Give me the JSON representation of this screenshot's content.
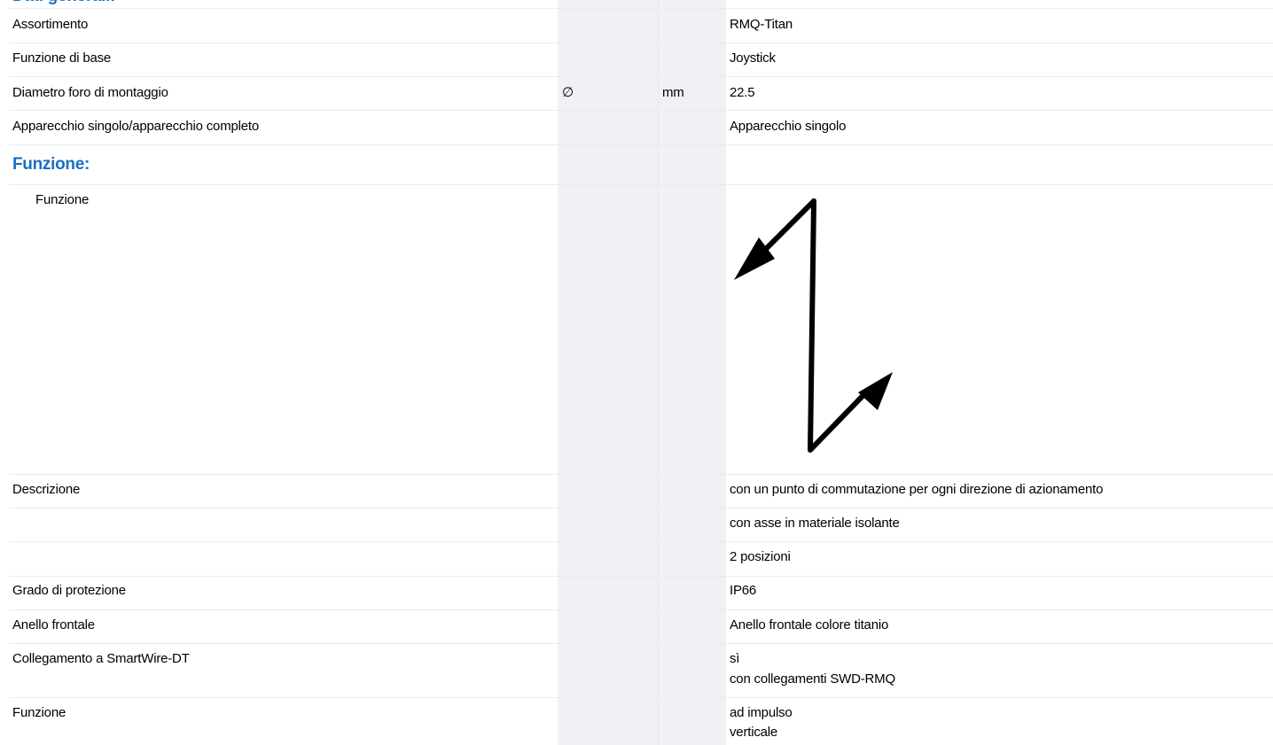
{
  "header": {
    "section_title_cut": "Dati generali:"
  },
  "rows": [
    {
      "label": "Assortimento",
      "symbol": "",
      "unit": "",
      "value": "RMQ-Titan"
    },
    {
      "label": "Funzione di base",
      "symbol": "",
      "unit": "",
      "value": "Joystick"
    },
    {
      "label": "Diametro foro di montaggio",
      "symbol": "∅",
      "unit": "mm",
      "value": "22.5"
    },
    {
      "label": "Apparecchio singolo/apparecchio completo",
      "symbol": "",
      "unit": "",
      "value": "Apparecchio singolo"
    }
  ],
  "funzione_section": {
    "title": "Funzione:",
    "function_label": "Funzione",
    "diagram_icon": "joystick-two-direction-arrows-icon"
  },
  "rows2": [
    {
      "label": "Descrizione",
      "value": "con un punto di commutazione per ogni direzione di azionamento"
    },
    {
      "label": "",
      "value": "con asse in materiale isolante"
    },
    {
      "label": "",
      "value": "2 posizioni"
    },
    {
      "label": "Grado di protezione",
      "value": "IP66"
    },
    {
      "label": "Anello frontale",
      "value": "Anello frontale colore titanio"
    },
    {
      "label": "Collegamento a SmartWire-DT",
      "value": "sì",
      "value2": "con collegamenti SWD-RMQ"
    },
    {
      "label": "Funzione",
      "value": "ad impulso",
      "value2": "verticale"
    }
  ],
  "colors": {
    "heading": "#1a6fc4",
    "shaded_column": "#eff1f5",
    "row_border": "#e9ebef"
  }
}
